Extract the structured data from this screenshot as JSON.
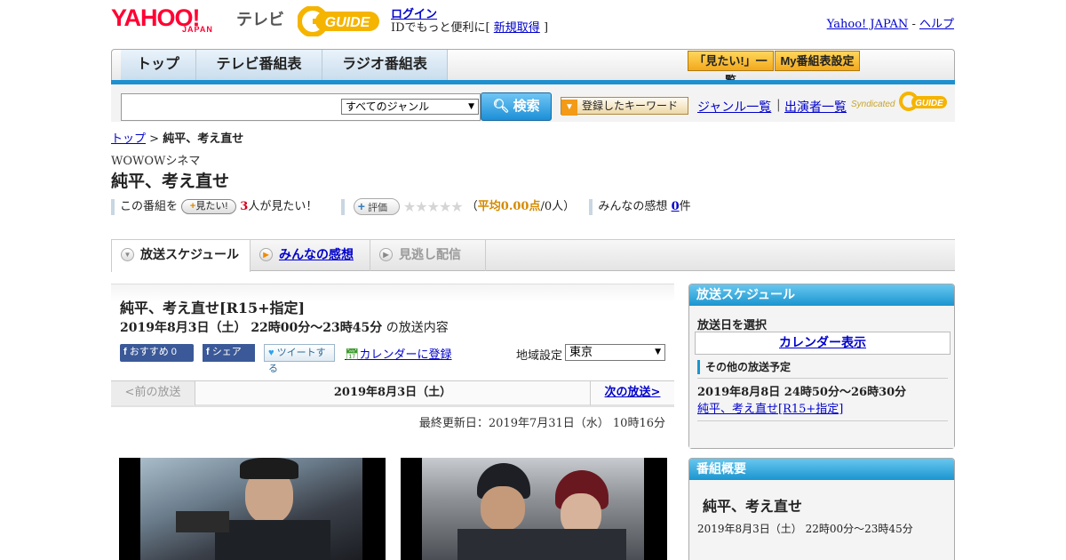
{
  "header": {
    "logo_yahoo": "YAHOO!",
    "logo_japan": "JAPAN",
    "logo_tv": "テレビ",
    "logo_guide": "GUIDE",
    "login": "ログイン",
    "login_sub_prefix": "IDでもっと便利に[",
    "register": "新規取得",
    "login_sub_suffix": "]",
    "yahoo_japan_link": "Yahoo! JAPAN",
    "dash": " - ",
    "help_link": "ヘルプ"
  },
  "nav": {
    "tabs": [
      "トップ",
      "テレビ番組表",
      "ラジオ番組表"
    ],
    "mitai_list": "「見たい!」一覧",
    "my_settings": "My番組表設定"
  },
  "search": {
    "query": "",
    "genre_selected": "すべてのジャンル",
    "button": "検索",
    "keyword_button": "登録したキーワード",
    "genre_list": "ジャンル一覧",
    "separator": "|",
    "cast_list": "出演者一覧",
    "syndicated": "Syndicated",
    "synd_logo": "GUIDE"
  },
  "breadcrumb": {
    "top": "トップ",
    "sep": " > ",
    "current": "純平、考え直せ"
  },
  "program": {
    "channel": "WOWOWシネマ",
    "title": "純平、考え直せ",
    "this_program": "この番組を",
    "mitai_button": "見たい!",
    "mitai_count": "3",
    "mitai_suffix": "人が見たい！",
    "rate_button": "評価",
    "stars": "★★★★★",
    "avg_prefix": "（",
    "avg_label": "平均0.00点",
    "avg_suffix": "/0人）",
    "impressions_label": "みんなの感想",
    "impressions_count": "0",
    "impressions_unit": "件"
  },
  "tabs": [
    {
      "label": "放送スケジュール"
    },
    {
      "label": "みんなの感想"
    },
    {
      "label": "見逃し配信"
    }
  ],
  "episode": {
    "title": "純平、考え直せ[R15+指定]",
    "datetime": "2019年8月3日（土）  22時00分～23時45分",
    "datetime_suffix": " の放送内容",
    "fb_recommend": "おすすめ 0",
    "fb_share": "シェア",
    "tweet": "ツイートする",
    "calendar_register": "カレンダーに登録",
    "region_label": "地域設定",
    "region_value": "東京",
    "prev": "<前の放送",
    "current_date": "2019年8月3日（土）",
    "next": "次の放送>",
    "last_updated": "最終更新日：2019年7月31日（水）  10時16分"
  },
  "sidebar": {
    "schedule_head": "放送スケジュール",
    "pick_date": "放送日を選択",
    "calendar_view": "カレンダー表示",
    "other_head": "その他の放送予定",
    "other_time": "2019年8月8日  24時50分～26時30分",
    "other_title": "純平、考え直せ[R15+指定]",
    "summary_head": "番組概要",
    "summary_title": "純平、考え直せ",
    "summary_time": "2019年8月3日（土）  22時00分～23時45分"
  },
  "colors": {
    "accent_blue": "#1b95cf",
    "yahoo_red": "#ff0033",
    "guide_yellow": "#f5b400",
    "link": "#0000cc"
  }
}
